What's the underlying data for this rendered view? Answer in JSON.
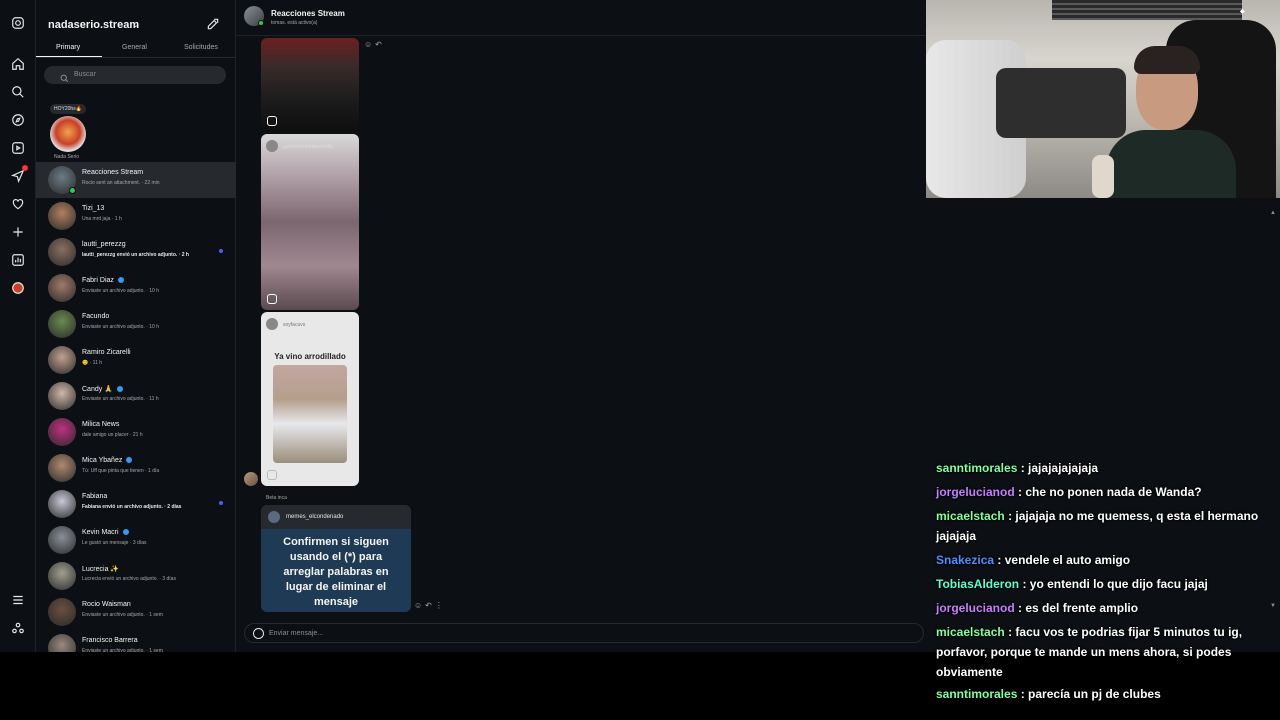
{
  "rail": {
    "icons": [
      "instagram-icon",
      "home-icon",
      "search-icon",
      "explore-icon",
      "reels-icon",
      "messages-icon",
      "notifications-icon",
      "create-icon",
      "dashboard-icon",
      "profile-icon",
      "menu-icon",
      "threads-icon"
    ]
  },
  "inbox": {
    "account_name": "nadaserio.stream",
    "tabs": [
      "Primary",
      "General",
      "Solicitudes"
    ],
    "search_placeholder": "Buscar",
    "note": {
      "bubble": "HOY20hs🔥",
      "name": "Nada Serio"
    },
    "threads": [
      {
        "name": "Reacciones Stream",
        "preview": "Rocio sent an attachment. · 22 min",
        "unread": false,
        "active": true,
        "online": true,
        "verified": false,
        "color": "#6b7c86"
      },
      {
        "name": "Tizi_13",
        "preview": "Una mrd jaja · 1 h",
        "unread": false,
        "active": false,
        "online": false,
        "verified": false,
        "color": "#b08060"
      },
      {
        "name": "lautti_perezzg",
        "preview": "lautti_perezzg envió un archivo adjunto. · 2 h",
        "unread": true,
        "active": false,
        "online": false,
        "verified": false,
        "color": "#8a7060"
      },
      {
        "name": "Fabri Diaz",
        "preview": "Enviaste un archivo adjunto. · 10 h",
        "unread": false,
        "active": false,
        "online": false,
        "verified": true,
        "color": "#a07a6a"
      },
      {
        "name": "Facundo",
        "preview": "Enviaste un archivo adjunto. · 10 h",
        "unread": false,
        "active": false,
        "online": false,
        "verified": false,
        "color": "#6a8a50"
      },
      {
        "name": "Ramiro Zicarelli",
        "preview": "😊 · 11 h",
        "unread": false,
        "active": false,
        "online": false,
        "verified": false,
        "color": "#c0a090"
      },
      {
        "name": "Candy 🙏",
        "preview": "Enviaste un archivo adjunto. · 11 h",
        "unread": false,
        "active": false,
        "online": false,
        "verified": true,
        "color": "#d0b8a8"
      },
      {
        "name": "Milica News",
        "preview": "dale amigo un placer · 21 h",
        "unread": false,
        "active": false,
        "online": false,
        "verified": false,
        "color": "#c03080"
      },
      {
        "name": "Mica Ybañez",
        "preview": "Tú: Uff que pinta que tienen · 1 día",
        "unread": false,
        "active": false,
        "online": false,
        "verified": true,
        "color": "#b08a70"
      },
      {
        "name": "Fabiana",
        "preview": "Fabiana envió un archivo adjunto. · 2 días",
        "unread": true,
        "active": false,
        "online": false,
        "verified": false,
        "color": "#c8c8d8"
      },
      {
        "name": "Kevin Macri",
        "preview": "Le gustó un mensaje · 3 días",
        "unread": false,
        "active": false,
        "online": false,
        "verified": true,
        "color": "#8a9098"
      },
      {
        "name": "Lucrecia ✨",
        "preview": "Lucrecia envió un archivo adjunto. · 3 días",
        "unread": false,
        "active": false,
        "online": false,
        "verified": false,
        "color": "#a0a090"
      },
      {
        "name": "Rocio Waisman",
        "preview": "Enviaste un archivo adjunto. · 1 sem",
        "unread": false,
        "active": false,
        "online": false,
        "verified": false,
        "color": "#6a5040"
      },
      {
        "name": "Francisco Barrera",
        "preview": "Enviaste un archivo adjunto. · 1 sem",
        "unread": false,
        "active": false,
        "online": false,
        "verified": false,
        "color": "#9a8a80"
      }
    ]
  },
  "conversation": {
    "title": "Reacciones Stream",
    "subtitle": "tomas. está activo(a)",
    "media_users": [
      "gustavoomelabacriolla",
      "soyfacuvs"
    ],
    "media3_caption": "Ya vino arrodillado",
    "reply_label": "Beta inca",
    "shared_post": {
      "user": "memes_elcondenado",
      "text": "Confirmen si siguen usando el (*) para arreglar palabras en lugar de eliminar el mensaje"
    },
    "composer_placeholder": "Enviar mensaje..."
  },
  "chat": [
    {
      "user": "sanntimorales",
      "color": "#7fffa0",
      "text": ": jajajajajajaja"
    },
    {
      "user": "jorgelucianod",
      "color": "#c77dff",
      "text": ": che no ponen nada de Wanda?"
    },
    {
      "user": "micaelstach",
      "color": "#7fffa0",
      "text": ": jajajaja no me quemess, q esta el hermano jajajaja"
    },
    {
      "user": "Snakezica",
      "color": "#4a90ff",
      "text": ": vendele el auto amigo"
    },
    {
      "user": "TobiasAlderon",
      "color": "#5fffd0",
      "text": ": yo entendi lo que dijo facu jajaj"
    },
    {
      "user": "jorgelucianod",
      "color": "#c77dff",
      "text": ": es del frente amplio"
    },
    {
      "user": "micaelstach",
      "color": "#7fffa0",
      "text": ": facu vos te podrias fijar 5 minutos tu ig, porfavor, porque te mande un mens ahora, si podes obviamente"
    },
    {
      "user": "sanntimorales",
      "color": "#7fffa0",
      "text": ": parecía un pj de clubes"
    }
  ]
}
